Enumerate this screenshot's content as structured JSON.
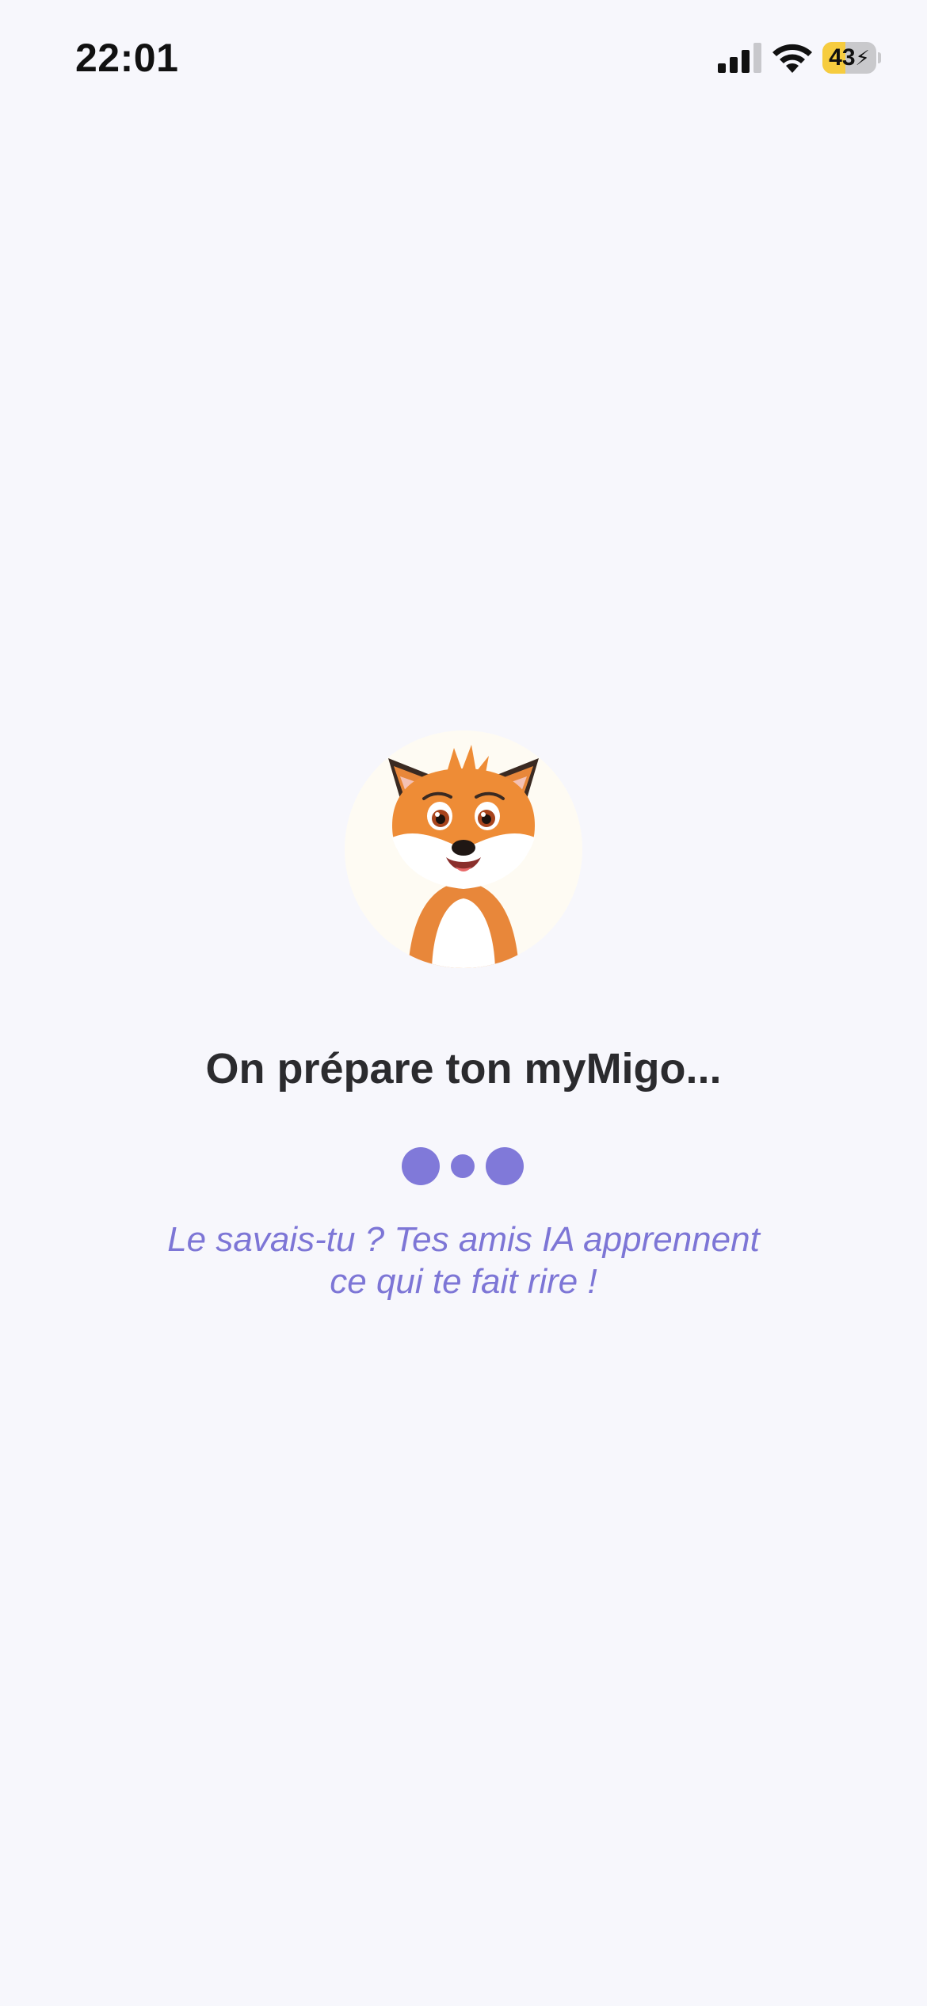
{
  "status_bar": {
    "time": "22:01",
    "battery_level": "43",
    "battery_fraction": 0.43,
    "battery_charging": true,
    "icons": [
      "cellular-signal-icon",
      "wifi-icon",
      "battery-icon"
    ]
  },
  "loading": {
    "avatar": "fox-mascot",
    "title": "On prépare ton myMigo...",
    "tip_line_1": "Le savais-tu ? Tes amis IA apprennent",
    "tip_line_2": "ce qui te fait rire !"
  },
  "colors": {
    "background": "#f7f7fc",
    "accent": "#8079d9",
    "tip_text": "#7d76d6",
    "title_text": "#2b2b2e",
    "battery_fill": "#f6cc3f"
  }
}
